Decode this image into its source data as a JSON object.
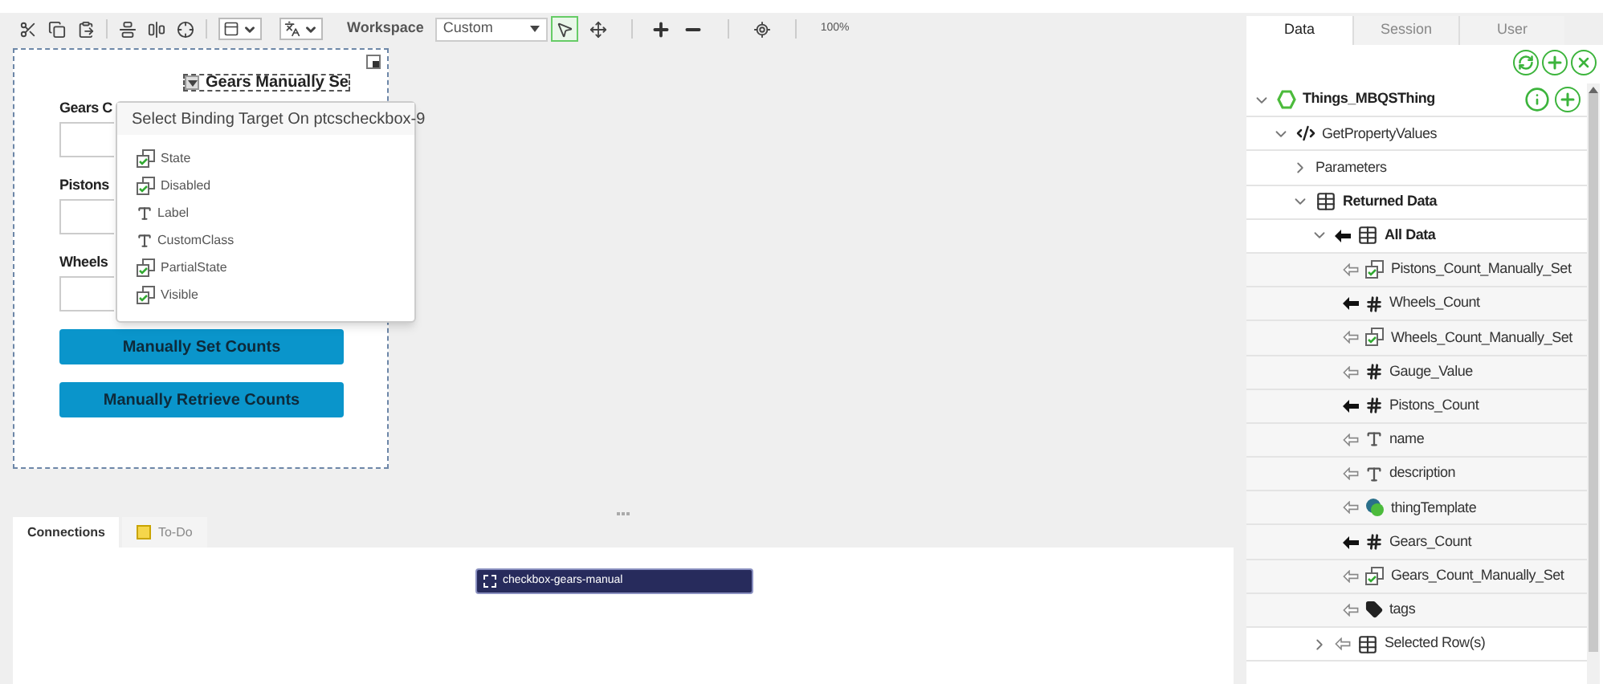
{
  "toolbar": {
    "workspace_label": "Workspace",
    "workspace_value": "Custom",
    "zoom": "100%",
    "pointer_selected": true
  },
  "canvas": {
    "labels": [
      "Gears C",
      "Pistons",
      "Wheels"
    ],
    "checkbox_label": "Gears Manually Se",
    "buttons": [
      "Manually Set Counts",
      "Manually Retrieve Counts"
    ]
  },
  "binding_popup": {
    "title": "Select Binding Target On ptcscheckbox-9",
    "items": [
      {
        "label": "State",
        "kind": "boolean"
      },
      {
        "label": "Disabled",
        "kind": "boolean"
      },
      {
        "label": "Label",
        "kind": "string"
      },
      {
        "label": "CustomClass",
        "kind": "string"
      },
      {
        "label": "PartialState",
        "kind": "boolean"
      },
      {
        "label": "Visible",
        "kind": "boolean"
      }
    ]
  },
  "bottom_tabs": [
    {
      "label": "Connections",
      "selected": true
    },
    {
      "label": "To-Do",
      "selected": false
    }
  ],
  "connection_node": {
    "label": "checkbox-gears-manual"
  },
  "panel_tabs": [
    {
      "label": "Data",
      "selected": true
    },
    {
      "label": "Session",
      "selected": false
    },
    {
      "label": "User",
      "selected": false
    }
  ],
  "tree": [
    {
      "name": "Things_MBQSThing",
      "kind": "thing",
      "bold": true,
      "expanded": true,
      "children": [
        {
          "name": "GetPropertyValues",
          "kind": "service",
          "bold": false,
          "expanded": true,
          "children": [
            {
              "name": "Parameters",
              "kind": "folder",
              "bold": false,
              "expanded": false
            },
            {
              "name": "Returned Data",
              "kind": "infotable",
              "bold": true,
              "expanded": true,
              "children": [
                {
                  "name": "All Data",
                  "kind": "infotable",
                  "bold": true,
                  "expanded": true,
                  "outgoing": true,
                  "children": [
                    {
                      "name": "Pistons_Count_Manually_Set",
                      "kind": "boolean",
                      "bold": false,
                      "outgoing": false
                    },
                    {
                      "name": "Wheels_Count",
                      "kind": "number",
                      "bold": false,
                      "outgoing": true
                    },
                    {
                      "name": "Wheels_Count_Manually_Set",
                      "kind": "boolean",
                      "bold": false,
                      "outgoing": false
                    },
                    {
                      "name": "Gauge_Value",
                      "kind": "number",
                      "bold": false,
                      "outgoing": false
                    },
                    {
                      "name": "Pistons_Count",
                      "kind": "number",
                      "bold": false,
                      "outgoing": true
                    },
                    {
                      "name": "name",
                      "kind": "string",
                      "bold": false,
                      "outgoing": false
                    },
                    {
                      "name": "description",
                      "kind": "string",
                      "bold": false,
                      "outgoing": false
                    },
                    {
                      "name": "thingTemplate",
                      "kind": "thingtemplate",
                      "bold": false,
                      "outgoing": false
                    },
                    {
                      "name": "Gears_Count",
                      "kind": "number",
                      "bold": false,
                      "outgoing": true
                    },
                    {
                      "name": "Gears_Count_Manually_Set",
                      "kind": "boolean",
                      "bold": false,
                      "outgoing": false
                    },
                    {
                      "name": "tags",
                      "kind": "tags",
                      "bold": false,
                      "outgoing": false
                    }
                  ]
                },
                {
                  "name": "Selected Row(s)",
                  "kind": "infotable",
                  "bold": false,
                  "expanded": false,
                  "outgoing": false
                }
              ]
            }
          ]
        }
      ]
    }
  ]
}
